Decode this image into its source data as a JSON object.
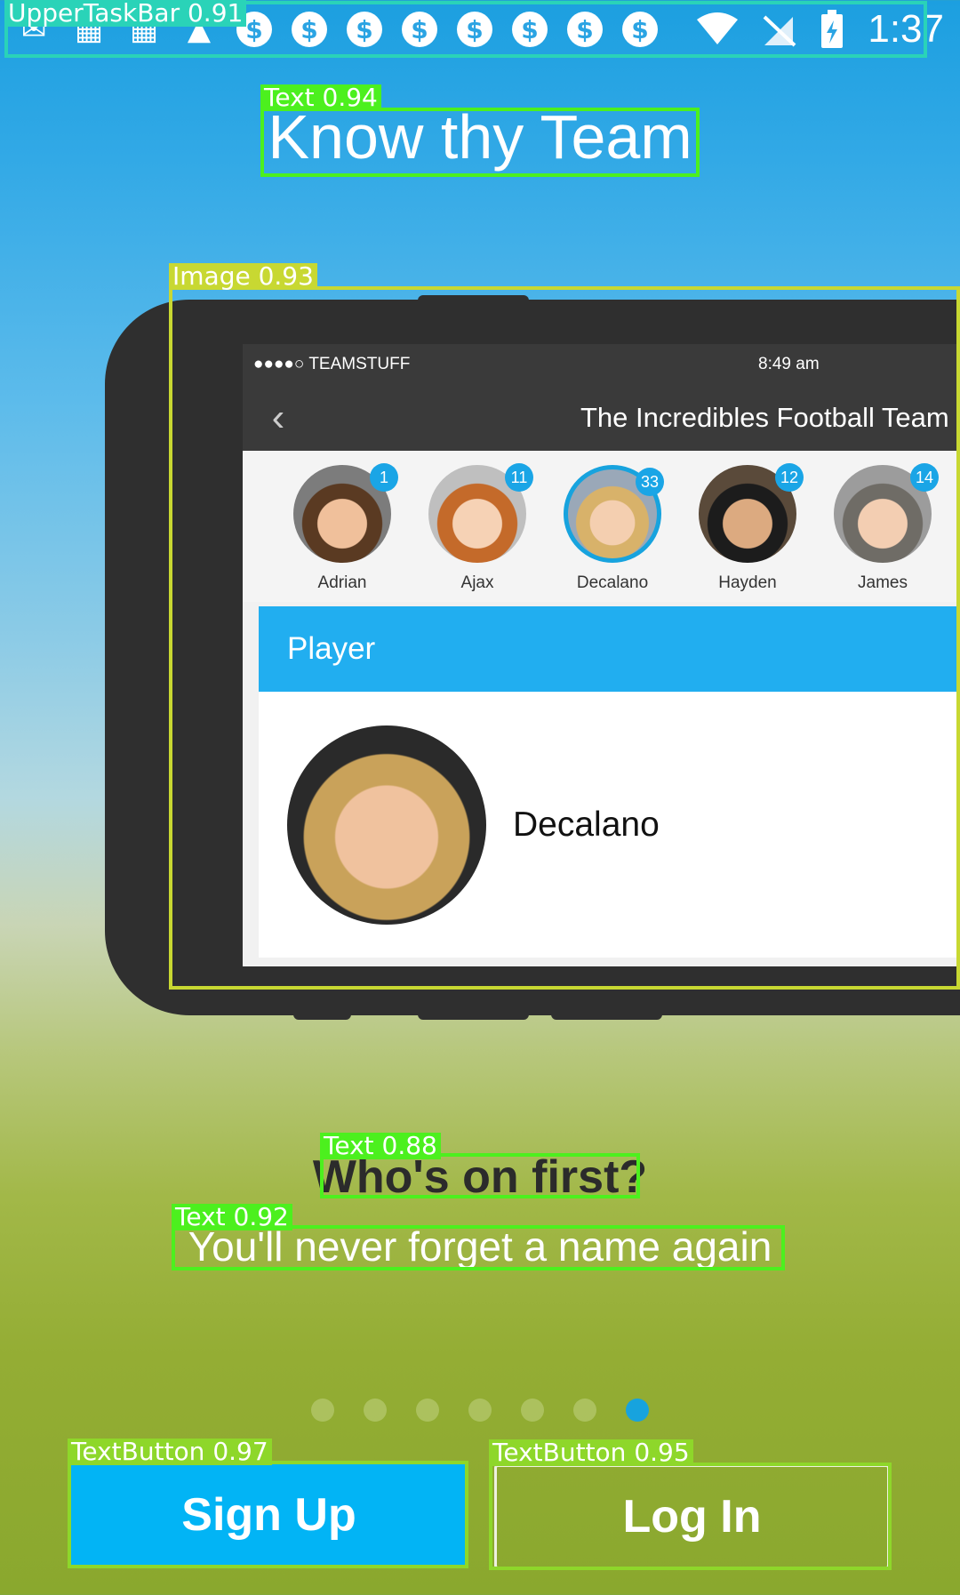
{
  "status_bar": {
    "left_icons": [
      "mail-icon",
      "gift-icon",
      "gift-icon",
      "warning-icon"
    ],
    "coin_icon_count": 8,
    "coin_glyph": "$",
    "right_icons": [
      "wifi-icon",
      "no-sim-icon",
      "battery-charging-icon"
    ],
    "time": "1:37"
  },
  "title": "Know thy Team",
  "phone_screen": {
    "carrier": "●●●●○ TEAMSTUFF",
    "time": "8:49 am",
    "back_glyph": "‹",
    "team_title": "The Incredibles Football Team",
    "players": [
      {
        "name": "Adrian",
        "number": "1",
        "selected": false
      },
      {
        "name": "Ajax",
        "number": "11",
        "selected": false
      },
      {
        "name": "Decalano",
        "number": "33",
        "selected": true
      },
      {
        "name": "Hayden",
        "number": "12",
        "selected": false
      },
      {
        "name": "James",
        "number": "14",
        "selected": false
      }
    ],
    "section_label": "Player",
    "selected_player": "Decalano"
  },
  "heading": "Who's on first?",
  "subheading": "You'll never forget a name again",
  "pager": {
    "total": 7,
    "active_index": 6
  },
  "buttons": {
    "sign_up": "Sign Up",
    "log_in": "Log In"
  },
  "overlay_labels": {
    "status_bar": "UpperTaskBar 0.91",
    "title": "Text 0.94",
    "image": "Image 0.93",
    "heading": "Text 0.88",
    "subheading": "Text 0.92",
    "sign_up": "TextButton 0.97",
    "log_in": "TextButton 0.95"
  },
  "colors": {
    "accent": "#17a3de",
    "sign_up_bg": "#02b4f5",
    "player_header": "#21aef0",
    "overlay_green": "#4cf01e",
    "overlay_cyan": "#2ad3b8",
    "overlay_yellow": "#c8d832"
  }
}
